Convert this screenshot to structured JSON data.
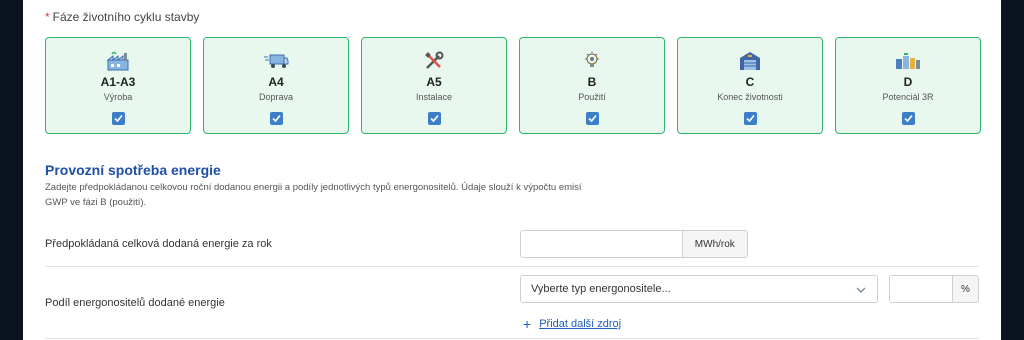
{
  "phases": {
    "label": "Fáze životního cyklu stavby",
    "required_mark": "*",
    "items": [
      {
        "code": "A1-A3",
        "name": "Výroba",
        "icon": "factory-icon",
        "checked": true
      },
      {
        "code": "A4",
        "name": "Doprava",
        "icon": "truck-icon",
        "checked": true
      },
      {
        "code": "A5",
        "name": "Instalace",
        "icon": "tools-icon",
        "checked": true
      },
      {
        "code": "B",
        "name": "Použití",
        "icon": "lightbulb-icon",
        "checked": true
      },
      {
        "code": "C",
        "name": "Konec životnosti",
        "icon": "warehouse-icon",
        "checked": true
      },
      {
        "code": "D",
        "name": "Potenciál 3R",
        "icon": "recycle-containers-icon",
        "checked": true
      }
    ]
  },
  "energy": {
    "title": "Provozní spotřeba energie",
    "description": "Zadejte předpokládanou celkovou roční dodanou energii a podíly jednotlivých typů energonositelů. Údaje slouží k výpočtu emisí GWP ve fázi B (použití).",
    "total_label": "Předpokládaná celková dodaná energie za rok",
    "total_value": "",
    "total_unit": "MWh/rok",
    "share_label": "Podíl energonositelů dodané energie",
    "carrier_placeholder": "Vyberte typ energonositele...",
    "share_value": "",
    "share_unit": "%",
    "add_label": "Přidat další zdroj",
    "add_icon": "+"
  },
  "colors": {
    "card_border": "#2fb86a",
    "card_bg": "#e9f8ef",
    "checkbox": "#3d7ec9",
    "title": "#1f4fa8",
    "link": "#1f5fbf",
    "required": "#e53935"
  }
}
